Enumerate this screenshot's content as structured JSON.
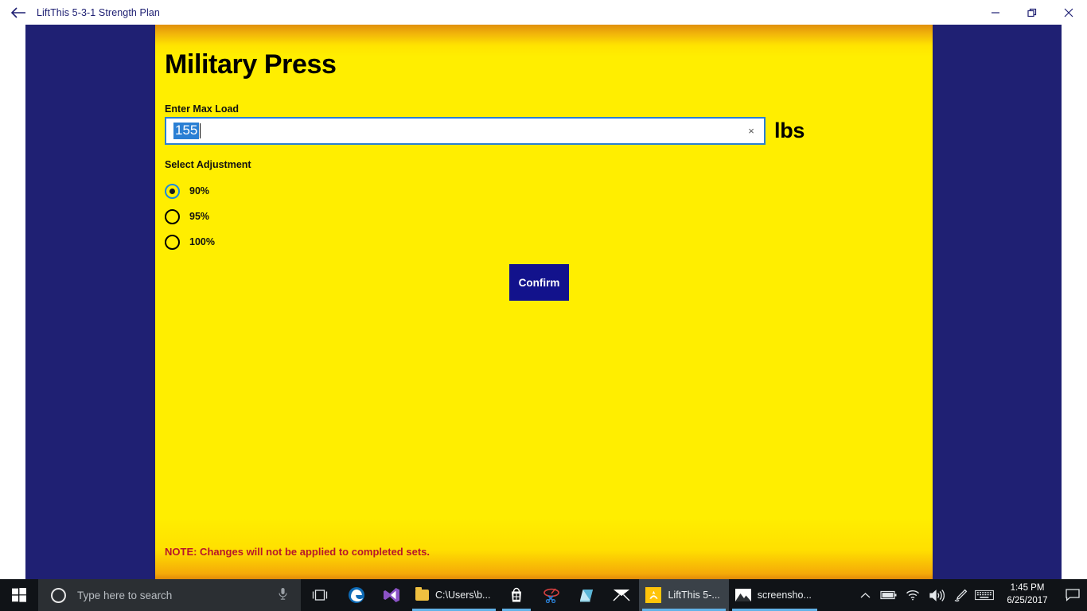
{
  "titlebar": {
    "back_icon": "back-arrow-icon",
    "title": "LiftThis 5-3-1 Strength Plan",
    "minimize_label": "minimize-icon",
    "restore_label": "restore-icon",
    "close_label": "close-icon"
  },
  "page": {
    "title": "Military Press",
    "max_load": {
      "label": "Enter Max Load",
      "value": "155",
      "placeholder": "",
      "clear_icon": "×",
      "unit": "lbs",
      "selected": true
    },
    "adjustment": {
      "label": "Select Adjustment",
      "options": [
        {
          "label": "90%",
          "selected": true
        },
        {
          "label": "95%",
          "selected": false
        },
        {
          "label": "100%",
          "selected": false
        }
      ]
    },
    "confirm_label": "Confirm",
    "note": "NOTE: Changes will not be applied to completed sets."
  },
  "colors": {
    "navy": "#1f2073",
    "yellow": "#ffee00",
    "orange": "#e0900c",
    "accent_blue": "#2a7fd4",
    "button_navy": "#12128c",
    "note_red": "#b8152b"
  },
  "taskbar": {
    "start_icon": "windows-start-icon",
    "search": {
      "cortana_icon": "cortana-circle-icon",
      "placeholder": "Type here to search",
      "mic_icon": "microphone-icon"
    },
    "taskview_icon": "task-view-icon",
    "items": [
      {
        "icon": "edge-icon",
        "label": "",
        "active": false,
        "running": false
      },
      {
        "icon": "visual-studio-icon",
        "label": "",
        "active": false,
        "running": false
      },
      {
        "icon": "file-explorer-icon",
        "label": "C:\\Users\\b...",
        "active": false,
        "running": true
      },
      {
        "icon": "microsoft-store-icon",
        "label": "",
        "active": false,
        "running": true
      },
      {
        "icon": "snipping-tool-icon",
        "label": "",
        "active": false,
        "running": false
      },
      {
        "icon": "sticky-notes-icon",
        "label": "",
        "active": false,
        "running": false
      },
      {
        "icon": "mail-icon",
        "label": "",
        "active": false,
        "running": false
      },
      {
        "icon": "liftthis-icon",
        "label": "LiftThis 5-...",
        "active": true,
        "running": true
      },
      {
        "icon": "photos-icon",
        "label": "screensho...",
        "active": false,
        "running": true
      }
    ],
    "tray": {
      "show_hidden_icon": "chevron-up-icon",
      "battery_icon": "battery-icon",
      "network_icon": "wifi-icon",
      "volume_icon": "volume-icon",
      "pen_icon": "pen-icon",
      "keyboard_icon": "keyboard-icon",
      "time": "1:45 PM",
      "date": "6/25/2017",
      "action_center_icon": "action-center-icon"
    }
  }
}
